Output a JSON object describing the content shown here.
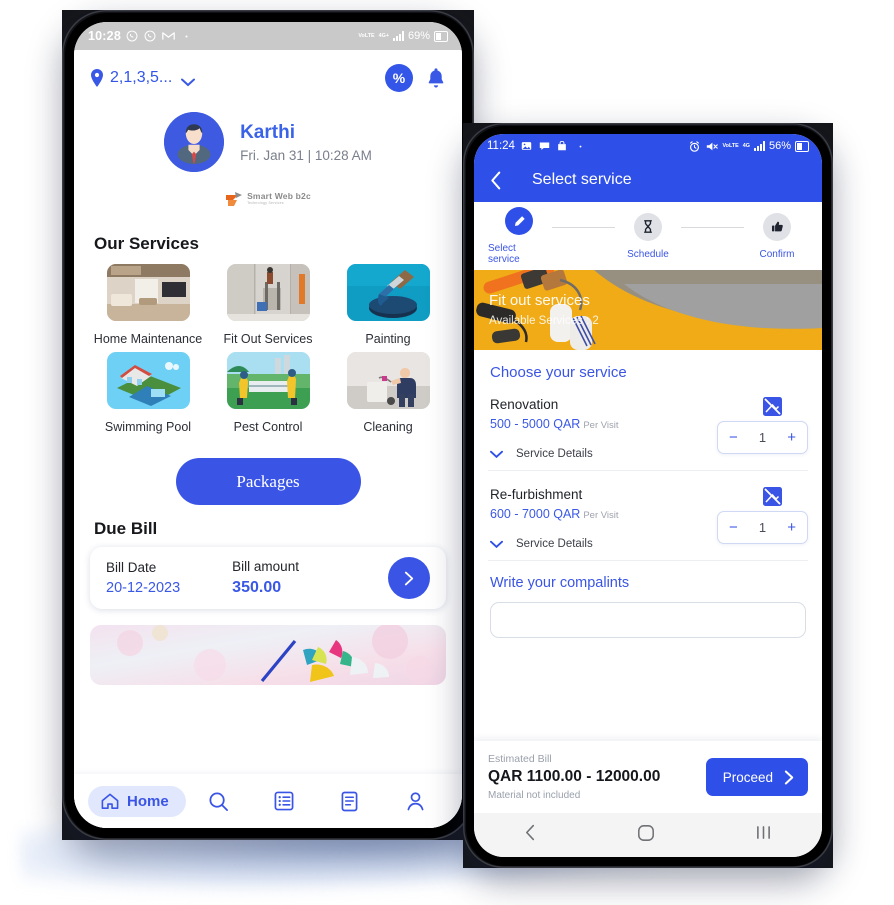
{
  "phone1": {
    "status_bar": {
      "time": "10:28",
      "icons": [
        "whatsapp-icon",
        "whatsapp-icon",
        "gmail-icon",
        "dot-icon"
      ],
      "network_primary": "VoLTE",
      "network_secondary": "4G+",
      "battery": "69%"
    },
    "header": {
      "location": "2,1,3,5...",
      "location_icon": "location-pin-icon",
      "dropdown_icon": "chevron-down-icon",
      "offers_badge": "%",
      "notification_icon": "bell-icon"
    },
    "profile": {
      "name": "Karthi",
      "datetime": "Fri. Jan 31 | 10:28 AM",
      "avatar_icon": "user-avatar"
    },
    "brand": {
      "name": "Smart Web b2c",
      "tagline": "Technology Services"
    },
    "services": {
      "title": "Our Services",
      "items": [
        {
          "label": "Home Maintenance",
          "image": "living-room-photo"
        },
        {
          "label": "Fit Out Services",
          "image": "interior-construction-photo"
        },
        {
          "label": "Painting",
          "image": "paint-brush-photo"
        },
        {
          "label": "Swimming Pool",
          "image": "pool-house-illustration"
        },
        {
          "label": "Pest Control",
          "image": "pest-control-illustration"
        },
        {
          "label": "Cleaning",
          "image": "cleaning-worker-photo"
        }
      ]
    },
    "packages_button": "Packages",
    "due_bill": {
      "title": "Due Bill",
      "date_label": "Bill Date",
      "date_value": "20-12-2023",
      "amount_label": "Bill amount",
      "amount_value": "350.00",
      "go_icon": "chevron-right-icon"
    },
    "promo": {
      "image": "cleaning-supplies-banner"
    },
    "bottom_nav": {
      "active_label": "Home",
      "items": [
        {
          "name": "home",
          "icon": "home-icon",
          "label": "Home",
          "active": true
        },
        {
          "name": "search",
          "icon": "search-icon",
          "label": "",
          "active": false
        },
        {
          "name": "bookings",
          "icon": "list-icon",
          "label": "",
          "active": false
        },
        {
          "name": "invoices",
          "icon": "document-icon",
          "label": "",
          "active": false
        },
        {
          "name": "account",
          "icon": "person-icon",
          "label": "",
          "active": false
        }
      ]
    },
    "android_nav": [
      "back-icon",
      "home-circle-icon",
      "recents-icon"
    ]
  },
  "phone2": {
    "status_bar": {
      "time": "11:24",
      "icons": [
        "photos-icon",
        "message-icon",
        "bag-icon",
        "dot-icon"
      ],
      "right_icons": [
        "alarm-icon",
        "mute-icon"
      ],
      "network_primary": "VoLTE",
      "network_secondary": "4G",
      "battery": "56%"
    },
    "header": {
      "title": "Select service",
      "back_icon": "back-arrow-icon"
    },
    "stepper": [
      {
        "label": "Select service",
        "icon": "pencil-icon",
        "active": true
      },
      {
        "label": "Schedule",
        "icon": "hourglass-icon",
        "active": false
      },
      {
        "label": "Confirm",
        "icon": "thumbs-up-icon",
        "active": false
      }
    ],
    "banner": {
      "title": "Fit out services",
      "subtitle": "Available Services : 2",
      "image": "paint-rollers-photo"
    },
    "choose_label": "Choose your service",
    "services": [
      {
        "name": "Renovation",
        "price": "500 - 5000  QAR",
        "unit": "Per Visit",
        "details_label": "Service Details",
        "details_icon": "chevron-down-icon",
        "image_icon": "image-off-icon",
        "qty": "1",
        "minus": "−",
        "plus": "+"
      },
      {
        "name": "Re-furbishment",
        "price": "600 - 7000  QAR",
        "unit": "Per Visit",
        "details_label": "Service Details",
        "details_icon": "chevron-down-icon",
        "image_icon": "image-off-icon",
        "qty": "1",
        "minus": "−",
        "plus": "+"
      }
    ],
    "complaints": {
      "label": "Write your compalints",
      "placeholder": ""
    },
    "footer": {
      "estimate_label": "Estimated Bill",
      "estimate_value": "QAR 1100.00 - 12000.00",
      "note": "Material not included",
      "proceed_label": "Proceed",
      "proceed_icon": "chevron-right-icon"
    },
    "android_nav": [
      "back-icon",
      "home-circle-icon",
      "recents-icon"
    ]
  },
  "colors": {
    "brand_blue": "#3a55e6",
    "header_blue": "#2f50e8",
    "link_blue": "#3a58e6",
    "banner_yellow": "#f0ab16",
    "status_gray": "#c9c9c9"
  }
}
